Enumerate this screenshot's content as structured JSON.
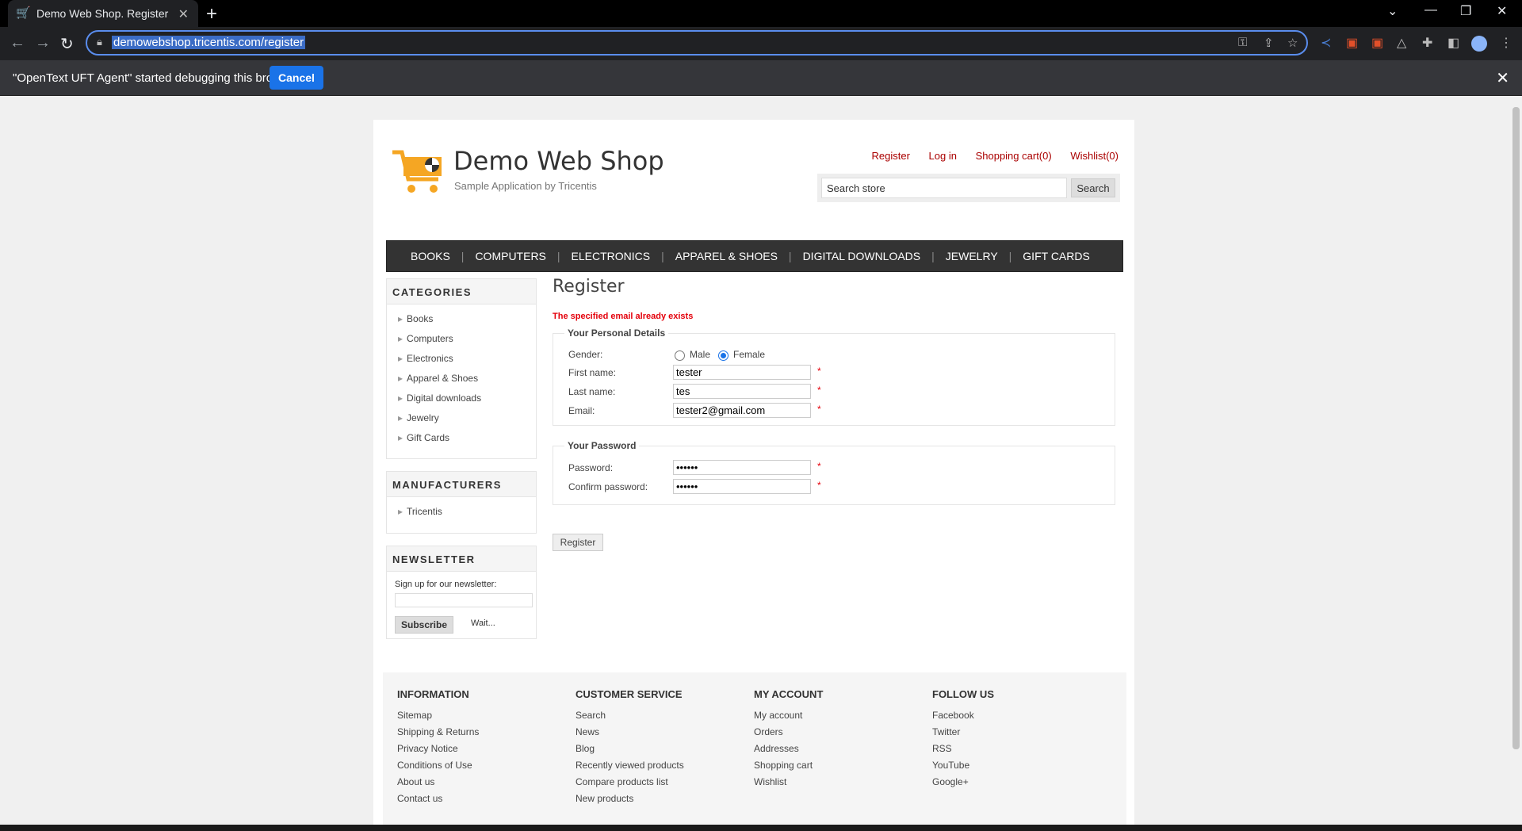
{
  "browser": {
    "tab_title": "Demo Web Shop. Register",
    "url": "demowebshop.tricentis.com/register",
    "infobar_message": "\"OpenText UFT Agent\" started debugging this browser",
    "infobar_cancel": "Cancel"
  },
  "header": {
    "site_name": "Demo Web Shop",
    "tagline": "Sample Application by Tricentis",
    "links": {
      "register": "Register",
      "login": "Log in",
      "cart": "Shopping cart(0)",
      "wishlist": "Wishlist(0)"
    },
    "search_placeholder": "Search store",
    "search_button": "Search"
  },
  "menu": [
    "BOOKS",
    "COMPUTERS",
    "ELECTRONICS",
    "APPAREL & SHOES",
    "DIGITAL DOWNLOADS",
    "JEWELRY",
    "GIFT CARDS"
  ],
  "sidebar": {
    "categories_title": "CATEGORIES",
    "categories": [
      "Books",
      "Computers",
      "Electronics",
      "Apparel & Shoes",
      "Digital downloads",
      "Jewelry",
      "Gift Cards"
    ],
    "manufacturers_title": "MANUFACTURERS",
    "manufacturers": [
      "Tricentis"
    ],
    "newsletter_title": "NEWSLETTER",
    "newsletter_text": "Sign up for our newsletter:",
    "subscribe": "Subscribe",
    "wait": "Wait..."
  },
  "form": {
    "title": "Register",
    "error": "The specified email already exists",
    "personal_legend": "Your Personal Details",
    "gender_label": "Gender:",
    "male": "Male",
    "female": "Female",
    "gender_selected": "Female",
    "first_name_label": "First name:",
    "first_name": "tester",
    "last_name_label": "Last name:",
    "last_name": "tes",
    "email_label": "Email:",
    "email": "tester2@gmail.com",
    "password_legend": "Your Password",
    "password_label": "Password:",
    "password": "••••••",
    "confirm_label": "Confirm password:",
    "confirm": "••••••",
    "required": "*",
    "register_button": "Register"
  },
  "footer": {
    "information": {
      "title": "INFORMATION",
      "links": [
        "Sitemap",
        "Shipping & Returns",
        "Privacy Notice",
        "Conditions of Use",
        "About us",
        "Contact us"
      ]
    },
    "customer_service": {
      "title": "CUSTOMER SERVICE",
      "links": [
        "Search",
        "News",
        "Blog",
        "Recently viewed products",
        "Compare products list",
        "New products"
      ]
    },
    "my_account": {
      "title": "MY ACCOUNT",
      "links": [
        "My account",
        "Orders",
        "Addresses",
        "Shopping cart",
        "Wishlist"
      ]
    },
    "follow_us": {
      "title": "FOLLOW US",
      "links": [
        "Facebook",
        "Twitter",
        "RSS",
        "YouTube",
        "Google+"
      ]
    }
  },
  "colors": {
    "accent_link": "#aa0000",
    "error": "#e4000b",
    "chrome_blue": "#1a73e8"
  }
}
